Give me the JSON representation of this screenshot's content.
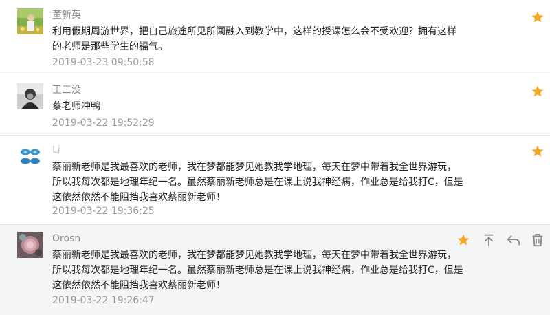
{
  "comments": [
    {
      "author": "董新英",
      "lines": [
        "利用假期周游世界，把自己旅途所见所闻融入到教学中，这样的授课怎么会不受欢迎？拥有这样",
        "的老师是那些学生的福气。"
      ],
      "time": "2019-03-23 09:50:58"
    },
    {
      "author": "王三没",
      "lines": [
        "蔡老师冲鸭"
      ],
      "time": "2019-03-22 19:52:29"
    },
    {
      "author": "Li",
      "lines": [
        "蔡丽新老师是我最喜欢的老师，我在梦都能梦见她教我学地理，每天在梦中带着我全世界游玩，",
        "所以我每次都是地理年纪一名。虽然蔡丽新老师总是在课上说我神经病，作业总是给我打C，但是",
        "这依然依然不能阻挡我喜欢蔡丽新老师！"
      ],
      "time": "2019-03-22 19:36:25"
    },
    {
      "author": "Orosn",
      "lines": [
        "蔡丽新老师是我最喜欢的老师，我在梦都能梦见她教我学地理，每天在梦中带着我全世界游玩，",
        "所以我每次都是地理年纪一名。虽然蔡丽新老师总是在课上说我神经病，作业总是给我打C，但是",
        "这依然依然不能阻挡我喜欢蔡丽新老师！"
      ],
      "time": "2019-03-22 19:26:47"
    }
  ],
  "colors": {
    "star": "#f5a623",
    "action_icon": "#888888",
    "hover_bg": "#f4f5f7"
  }
}
